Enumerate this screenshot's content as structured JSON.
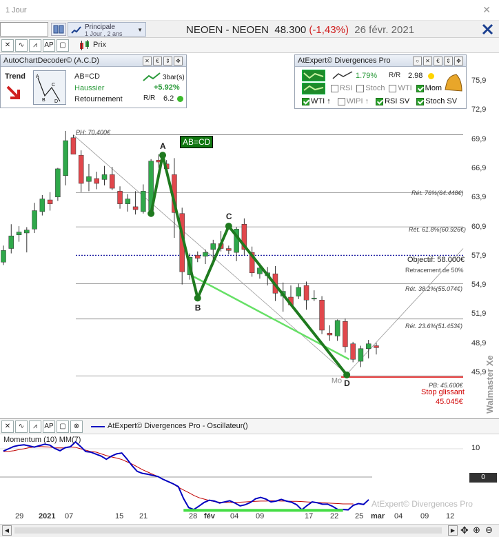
{
  "window": {
    "title": "1 Jour",
    "close": "✕"
  },
  "toolbar": {
    "search_value": "",
    "layout": {
      "name": "Principale",
      "sub": "1 Jour , 2 ans"
    },
    "symbol_title": "NEOEN - NEOEN",
    "last": "48.300",
    "change": "(-1,43%)",
    "date": "26 févr. 2021",
    "price_label": "Prix"
  },
  "acd_panel": {
    "title": "AutoChartDecoder© (A.C.D)",
    "trend_label": "Trend",
    "pattern": "AB=CD",
    "direction": "Haussier",
    "type": "Retournement",
    "bars": "3bar(s)",
    "perf": "+5.92%",
    "rr": "6.2",
    "shape_labels": [
      "A",
      "B",
      "C",
      "D"
    ]
  },
  "atexpert_panel": {
    "title": "AtExpert© Divergences Pro",
    "pct": "1.79%",
    "rr": "2.98",
    "checks": [
      {
        "label": "RSI",
        "checked": false
      },
      {
        "label": "Stoch",
        "checked": false
      },
      {
        "label": "WTI",
        "checked": false
      },
      {
        "label": "Mom",
        "checked": true
      }
    ],
    "checks2": [
      {
        "label": "WTI",
        "checked": true,
        "arrow": "↑"
      },
      {
        "label": "WIPI",
        "checked": false,
        "arrow": "↑"
      },
      {
        "label": "RSI SV",
        "checked": true
      },
      {
        "label": "Stoch SV",
        "checked": true
      }
    ]
  },
  "chart_data": {
    "type": "candlestick",
    "ph_label": "PH: 70.400€",
    "pb_label": "PB: 45.600€",
    "pattern_badge": "AB=CD",
    "watermark": "Walmaster Xe",
    "yticks": [
      "75,9",
      "72,9",
      "69,9",
      "66,9",
      "63,9",
      "60,9",
      "57,9",
      "54,9",
      "51,9",
      "48,9",
      "45,9"
    ],
    "ylim": [
      44.5,
      77.5
    ],
    "levels": [
      {
        "label": "Rét. 76%(64.448€)",
        "value": 64.448
      },
      {
        "label": "Rét. 61.8%(60.926€)",
        "value": 60.926
      },
      {
        "label": "Rét. 38.2%(55.074€)",
        "value": 55.074
      },
      {
        "label": "Rét. 23.6%(51.453€)",
        "value": 51.453
      }
    ],
    "objective": {
      "label": "Objectif: 58.000€",
      "sub": "Retracement de 50%",
      "value": 58.0
    },
    "stop": {
      "label": "Stop glissant",
      "value_label": "45.045€",
      "value": 45.045
    },
    "points": [
      {
        "name": "A",
        "value": 68.3
      },
      {
        "name": "B",
        "value": 53.6
      },
      {
        "name": "C",
        "value": 61.0
      },
      {
        "name": "D",
        "value": 45.7
      }
    ],
    "start_price": 62.3,
    "m_label": "Mo",
    "candles": [
      [
        57.3,
        59.0,
        57.0,
        58.5
      ],
      [
        58.7,
        61.2,
        58.2,
        60.0
      ],
      [
        60.1,
        61.0,
        59.4,
        60.4
      ],
      [
        60.3,
        60.9,
        58.3,
        60.6
      ],
      [
        60.7,
        63.4,
        60.3,
        62.6
      ],
      [
        62.5,
        64.2,
        62.1,
        63.8
      ],
      [
        63.7,
        64.5,
        62.6,
        63.3
      ],
      [
        64.0,
        67.0,
        63.6,
        66.9
      ],
      [
        66.2,
        70.8,
        65.2,
        69.8
      ],
      [
        70.1,
        70.4,
        68.8,
        68.4
      ],
      [
        68.3,
        68.8,
        64.5,
        65.4
      ],
      [
        65.6,
        67.4,
        64.6,
        66.1
      ],
      [
        65.9,
        66.6,
        64.8,
        65.4
      ],
      [
        65.8,
        67.2,
        65.2,
        66.3
      ],
      [
        66.3,
        67.1,
        64.7,
        64.9
      ],
      [
        64.6,
        65.1,
        62.8,
        63.3
      ],
      [
        63.3,
        64.3,
        62.5,
        63.8
      ],
      [
        63.0,
        64.6,
        62.2,
        62.7
      ],
      [
        62.5,
        65.3,
        62.3,
        64.6
      ],
      [
        62.6,
        67.9,
        62.0,
        67.7
      ],
      [
        67.8,
        68.4,
        67.0,
        67.6
      ],
      [
        67.4,
        67.8,
        66.4,
        66.9
      ],
      [
        66.3,
        68.0,
        59.8,
        62.4
      ],
      [
        62.3,
        62.9,
        55.0,
        56.3
      ],
      [
        56.0,
        58.2,
        55.5,
        57.8
      ],
      [
        58.0,
        58.4,
        57.3,
        57.7
      ],
      [
        57.9,
        58.6,
        57.1,
        58.3
      ],
      [
        58.6,
        59.6,
        57.4,
        59.2
      ],
      [
        59.2,
        60.5,
        58.4,
        58.7
      ],
      [
        58.7,
        59.0,
        58.1,
        58.5
      ],
      [
        58.3,
        60.9,
        57.4,
        60.7
      ],
      [
        61.2,
        61.8,
        58.0,
        58.6
      ],
      [
        58.3,
        58.9,
        55.8,
        56.2
      ],
      [
        56.1,
        57.2,
        55.6,
        56.7
      ],
      [
        55.9,
        56.8,
        54.9,
        56.2
      ],
      [
        56.1,
        56.9,
        53.3,
        54.1
      ],
      [
        53.8,
        55.2,
        52.2,
        54.3
      ],
      [
        53.7,
        54.9,
        52.8,
        52.9
      ],
      [
        53.8,
        55.1,
        53.5,
        54.7
      ],
      [
        54.9,
        55.3,
        52.4,
        53.4
      ],
      [
        53.5,
        54.4,
        53.3,
        53.6
      ],
      [
        53.4,
        53.8,
        49.9,
        50.3
      ],
      [
        50.0,
        50.8,
        49.2,
        49.8
      ],
      [
        49.7,
        51.4,
        49.2,
        51.3
      ],
      [
        51.2,
        51.5,
        48.0,
        48.6
      ],
      [
        48.9,
        49.1,
        47.0,
        47.3
      ],
      [
        47.1,
        48.7,
        46.5,
        48.4
      ],
      [
        48.4,
        49.3,
        47.4,
        48.9
      ],
      [
        48.7,
        49.0,
        47.8,
        48.5
      ]
    ]
  },
  "oscillator": {
    "title": "AtExpert© Divergences Pro - Oscillateur()",
    "series_label": "Momentum (10) MM(7)",
    "watermark": "AtExpert© Divergences Pro",
    "yticks": [
      "10",
      "0"
    ],
    "momentum": [
      9.2,
      10.0,
      10.8,
      11.2,
      11.4,
      11.0,
      10.6,
      11.1,
      11.6,
      11.3,
      10.1,
      9.3,
      10.4,
      10.7,
      12.4,
      10.8,
      9.0,
      8.8,
      8.1,
      7.4,
      6.3,
      7.4,
      8.2,
      8.5,
      6.4,
      4.0,
      2.0,
      1.3,
      1.0,
      0.6,
      0.2,
      -0.8,
      -1.6,
      -2.4,
      -3.4,
      -7.6,
      -10.8,
      -11.5,
      -10.3,
      -9.0,
      -8.2,
      -8.5,
      -9.2,
      -8.8,
      -8.4,
      -9.2,
      -10.2,
      -9.8,
      -9.0,
      -7.7,
      -7.2,
      -7.8,
      -8.8,
      -8.5,
      -7.9,
      -8.5,
      -8.9,
      -9.8,
      -11.6,
      -10.1,
      -8.8,
      -9.1,
      -9.6,
      -9.6,
      -10.4,
      -11.5,
      -11.5,
      -11.6,
      -10.0,
      -9.4,
      -9.7,
      -8.0
    ],
    "signal": [
      9.0,
      9.1,
      9.3,
      9.7,
      10.0,
      10.4,
      10.6,
      10.8,
      10.7,
      10.6,
      10.3,
      10.3,
      10.3,
      10.6,
      10.5,
      10.0,
      9.5,
      9.0,
      8.8,
      8.2,
      7.6,
      7.1,
      6.7,
      6.2,
      5.4,
      4.6,
      3.6,
      2.6,
      1.8,
      1.0,
      0.2,
      -0.7,
      -1.6,
      -2.5,
      -3.6,
      -4.6,
      -5.5,
      -6.5,
      -7.3,
      -7.8,
      -8.3,
      -8.7,
      -8.9,
      -9.0,
      -9.0,
      -9.0,
      -8.9,
      -8.8,
      -8.7,
      -8.6,
      -8.5,
      -8.5,
      -8.4,
      -8.4,
      -8.5,
      -8.5,
      -8.6,
      -8.6,
      -8.7,
      -8.8,
      -8.9,
      -9.0,
      -9.1,
      -9.2,
      -9.3,
      -9.4,
      -9.5,
      -9.5,
      -9.5
    ]
  },
  "xaxis": [
    "29",
    "2021",
    "07",
    "15",
    "21",
    "28",
    "fév",
    "04",
    "09",
    "17",
    "22",
    "25",
    "mar",
    "04",
    "09",
    "12"
  ]
}
